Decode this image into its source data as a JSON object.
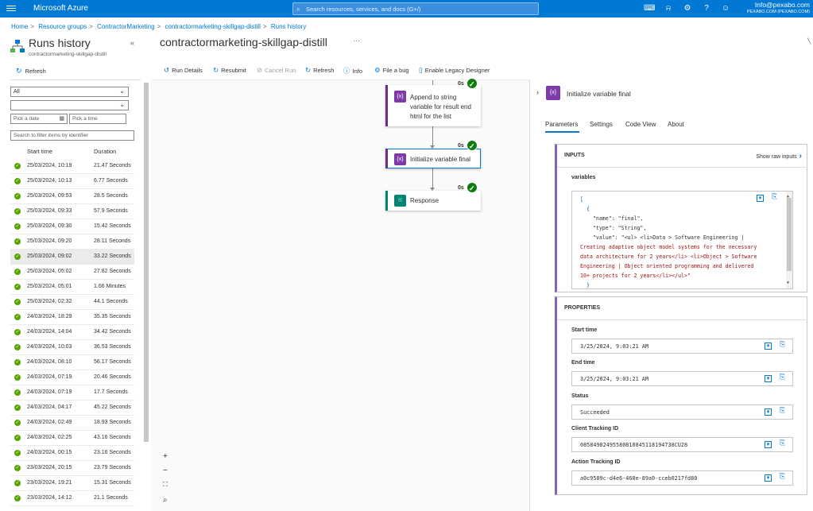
{
  "topbar": {
    "brand": "Microsoft Azure",
    "search_placeholder": "Search resources, services, and docs (G+/)",
    "account_email": "Info@pexabo.com",
    "account_org": "PEXABO.COM (PEXABO.COM)",
    "icons": [
      "cloud-shell-icon",
      "bell-icon",
      "settings-icon",
      "help-icon",
      "feedback-icon"
    ]
  },
  "breadcrumb": [
    "Home",
    "Resource groups",
    "ContractorMarketing",
    "contractormarketing-skillgap-distill",
    "Runs history"
  ],
  "left": {
    "title": "Runs history",
    "subtitle": "contractormarketing-skillgap-distill",
    "refresh_label": "Refresh",
    "status_filter": "All",
    "second_filter": "",
    "date_placeholder": "Pick a date",
    "time_placeholder": "Pick a time",
    "filter_placeholder": "Search to filter items by identifier",
    "col_start": "Start time",
    "col_duration": "Duration",
    "runs": [
      {
        "start": "25/03/2024, 10:19",
        "duration": "21.47 Seconds"
      },
      {
        "start": "25/03/2024, 10:13",
        "duration": "6.77 Seconds"
      },
      {
        "start": "25/03/2024, 09:53",
        "duration": "28.5 Seconds"
      },
      {
        "start": "25/03/2024, 09:33",
        "duration": "57.9 Seconds"
      },
      {
        "start": "25/03/2024, 09:30",
        "duration": "15.42 Seconds"
      },
      {
        "start": "25/03/2024, 09:20",
        "duration": "28.11 Seconds"
      },
      {
        "start": "25/03/2024, 09:02",
        "duration": "33.22 Seconds"
      },
      {
        "start": "25/03/2024, 05:02",
        "duration": "27.82 Seconds"
      },
      {
        "start": "25/03/2024, 05:01",
        "duration": "1.66 Minutes"
      },
      {
        "start": "25/03/2024, 02:32",
        "duration": "44.1 Seconds"
      },
      {
        "start": "24/03/2024, 18:29",
        "duration": "35.35 Seconds"
      },
      {
        "start": "24/03/2024, 14:04",
        "duration": "34.42 Seconds"
      },
      {
        "start": "24/03/2024, 10:03",
        "duration": "36.53 Seconds"
      },
      {
        "start": "24/03/2024, 08:10",
        "duration": "56.17 Seconds"
      },
      {
        "start": "24/03/2024, 07:19",
        "duration": "20.46 Seconds"
      },
      {
        "start": "24/03/2024, 07:19",
        "duration": "17.7 Seconds"
      },
      {
        "start": "24/03/2024, 04:17",
        "duration": "45.22 Seconds"
      },
      {
        "start": "24/03/2024, 02:49",
        "duration": "18.93 Seconds"
      },
      {
        "start": "24/03/2024, 02:25",
        "duration": "43.16 Seconds"
      },
      {
        "start": "24/03/2024, 00:15",
        "duration": "23.16 Seconds"
      },
      {
        "start": "23/03/2024, 20:15",
        "duration": "23.79 Seconds"
      },
      {
        "start": "23/03/2024, 19:21",
        "duration": "15.31 Seconds"
      },
      {
        "start": "23/03/2024, 14:12",
        "duration": "21.1 Seconds"
      }
    ]
  },
  "center": {
    "title": "contractormarketing-skillgap-distill",
    "toolbar": {
      "run_details": "Run Details",
      "resubmit": "Resubmit",
      "cancel_run": "Cancel Run",
      "refresh": "Refresh",
      "info": "Info",
      "file_bug": "File a bug",
      "legacy": "Enable Legacy Designer"
    },
    "nodes": [
      {
        "label_lines": [
          "Append to string",
          "variable for result end",
          "html for the list"
        ],
        "duration": "0s"
      },
      {
        "label_lines": [
          "Initialize variable final"
        ],
        "duration": "0s"
      },
      {
        "label_lines": [
          "Response"
        ],
        "duration": "0s"
      }
    ]
  },
  "right": {
    "title": "Initialize variable final",
    "tabs": [
      "Parameters",
      "Settings",
      "Code View",
      "About"
    ],
    "inputs": {
      "heading": "INPUTS",
      "show_raw": "Show raw inputs",
      "field": "variables",
      "code": [
        "[",
        "  {",
        "    \"name\": \"final\",",
        "    \"type\": \"String\",",
        "    \"value\": \"<ul> <li>Data > Software Engineering |",
        "Creating adaptive object model systems for the necessary",
        "data architecture for 2 years</li> <li>Object > Software",
        "Engineering | Object oriented programming and delivered",
        "10+ projects for 2 years</li></ul>\"",
        "  }"
      ]
    },
    "properties": {
      "heading": "PROPERTIES",
      "start_label": "Start time",
      "start_value": "3/25/2024, 9:03:21 AM",
      "end_label": "End time",
      "end_value": "3/25/2024, 9:03:21 AM",
      "status_label": "Status",
      "status_value": "Succeeded",
      "client_label": "Client Tracking ID",
      "client_value": "08584982495580810845118194738CU28",
      "action_label": "Action Tracking ID",
      "action_value": "a0c9509c-d4e6-460e-89a0-cceb0217fd80"
    }
  }
}
